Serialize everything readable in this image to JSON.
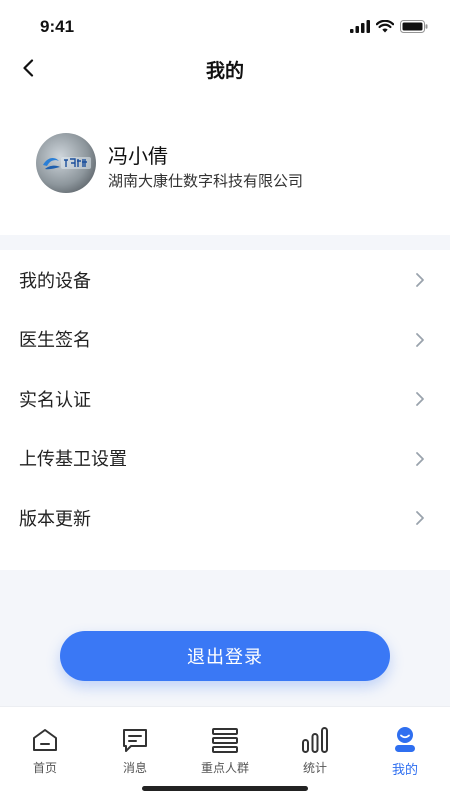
{
  "status_bar": {
    "time": "9:41"
  },
  "header": {
    "title": "我的"
  },
  "profile": {
    "name": "冯小倩",
    "company": "湖南大康仕数字科技有限公司"
  },
  "menu": {
    "items": [
      {
        "label": "我的设备"
      },
      {
        "label": "医生签名"
      },
      {
        "label": "实名认证"
      },
      {
        "label": "上传基卫设置"
      },
      {
        "label": "版本更新"
      }
    ]
  },
  "logout": {
    "label": "退出登录"
  },
  "tabs": [
    {
      "label": "首页",
      "icon": "home-icon"
    },
    {
      "label": "消息",
      "icon": "message-icon"
    },
    {
      "label": "重点人群",
      "icon": "list-icon"
    },
    {
      "label": "统计",
      "icon": "stats-icon"
    },
    {
      "label": "我的",
      "icon": "profile-icon"
    }
  ],
  "colors": {
    "accent": "#3a78f5",
    "active_tab": "#2f6ff0",
    "background": "#f4f6fa"
  }
}
